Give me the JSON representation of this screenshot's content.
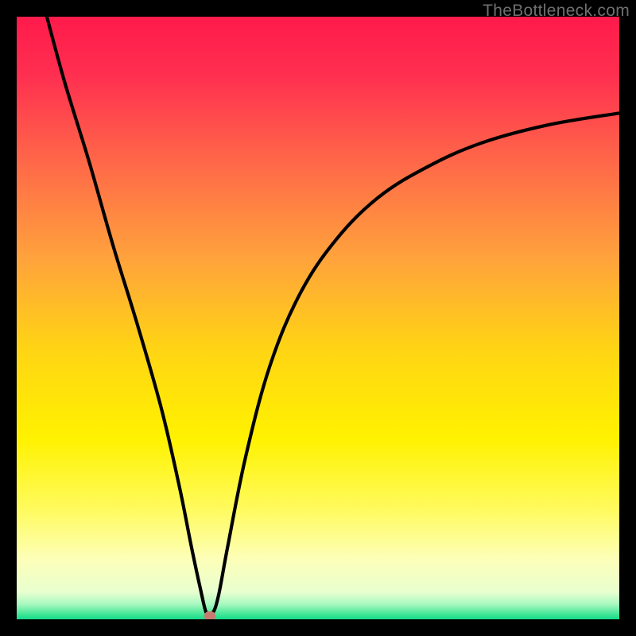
{
  "watermark": "TheBottleneck.com",
  "chart_data": {
    "type": "line",
    "title": "",
    "xlabel": "",
    "ylabel": "",
    "x_range": [
      0,
      100
    ],
    "y_range": [
      0,
      100
    ],
    "series": [
      {
        "name": "bottleneck-curve",
        "x": [
          5,
          8,
          12,
          16,
          20,
          24,
          27,
          29,
          30.5,
          31.5,
          32.5,
          33.5,
          35,
          38,
          42,
          47,
          53,
          60,
          68,
          77,
          88,
          100
        ],
        "y": [
          100,
          89,
          76,
          62,
          49,
          35,
          22,
          12,
          5,
          1,
          1,
          4,
          12,
          27,
          42,
          54,
          63,
          70,
          75,
          79,
          82,
          84
        ]
      }
    ],
    "marker": {
      "x": 32,
      "y": 0.5
    },
    "gradient_stops": [
      {
        "pos": 0,
        "color": "#ff1a4b"
      },
      {
        "pos": 0.1,
        "color": "#ff3050"
      },
      {
        "pos": 0.25,
        "color": "#ff6b48"
      },
      {
        "pos": 0.4,
        "color": "#ffa23c"
      },
      {
        "pos": 0.55,
        "color": "#ffd414"
      },
      {
        "pos": 0.7,
        "color": "#fff200"
      },
      {
        "pos": 0.82,
        "color": "#fffb60"
      },
      {
        "pos": 0.9,
        "color": "#fdffb8"
      },
      {
        "pos": 0.955,
        "color": "#e8ffd0"
      },
      {
        "pos": 0.975,
        "color": "#a8f8c0"
      },
      {
        "pos": 0.99,
        "color": "#4be89a"
      },
      {
        "pos": 1.0,
        "color": "#14db8a"
      }
    ]
  }
}
